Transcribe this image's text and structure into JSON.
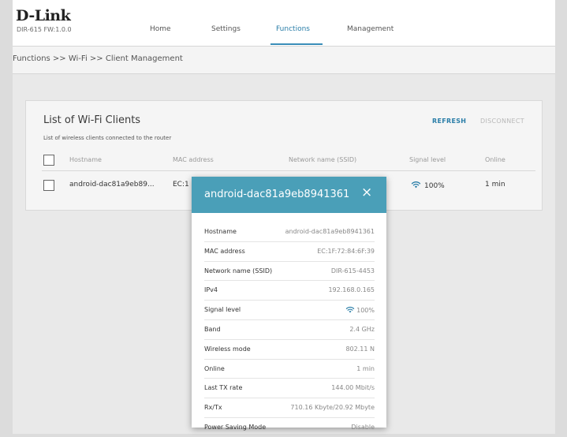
{
  "header": {
    "logo": "D-Link",
    "firmware": "DIR-615 FW:1.0.0",
    "nav": [
      "Home",
      "Settings",
      "Functions",
      "Management"
    ],
    "active_nav": "Functions"
  },
  "breadcrumb": "Functions >> Wi-Fi >> Client Management",
  "clients_card": {
    "title": "List of Wi-Fi Clients",
    "subtitle": "List of wireless clients connected to the router",
    "refresh_label": "REFRESH",
    "disconnect_label": "DISCONNECT",
    "columns": [
      "Hostname",
      "MAC address",
      "Network name (SSID)",
      "Signal level",
      "Online"
    ],
    "rows": [
      {
        "hostname": "android-dac81a9eb89...",
        "mac": "EC:1",
        "signal": "100%",
        "online": "1 min"
      }
    ]
  },
  "modal": {
    "title": "android-dac81a9eb8941361",
    "close_glyph": "×",
    "details": [
      {
        "key": "Hostname",
        "value": "android-dac81a9eb8941361"
      },
      {
        "key": "MAC address",
        "value": "EC:1F:72:84:6F:39"
      },
      {
        "key": "Network name (SSID)",
        "value": "DIR-615-4453"
      },
      {
        "key": "IPv4",
        "value": "192.168.0.165"
      },
      {
        "key": "Signal level",
        "value": "100%"
      },
      {
        "key": "Band",
        "value": "2.4 GHz"
      },
      {
        "key": "Wireless mode",
        "value": "802.11 N"
      },
      {
        "key": "Online",
        "value": "1 min"
      },
      {
        "key": "Last TX rate",
        "value": "144.00 Mbit/s"
      },
      {
        "key": "Rx/Tx",
        "value": "710.16 Kbyte/20.92 Mbyte"
      },
      {
        "key": "Power Saving Mode",
        "value": "Disable"
      }
    ]
  },
  "colors": {
    "accent": "#2a7ea8",
    "modal_header": "#4a9fb8",
    "disabled": "#b8b8b8"
  },
  "icons": {
    "wifi": "wifi-signal-icon",
    "close": "close-icon",
    "checkbox": "checkbox-icon"
  }
}
